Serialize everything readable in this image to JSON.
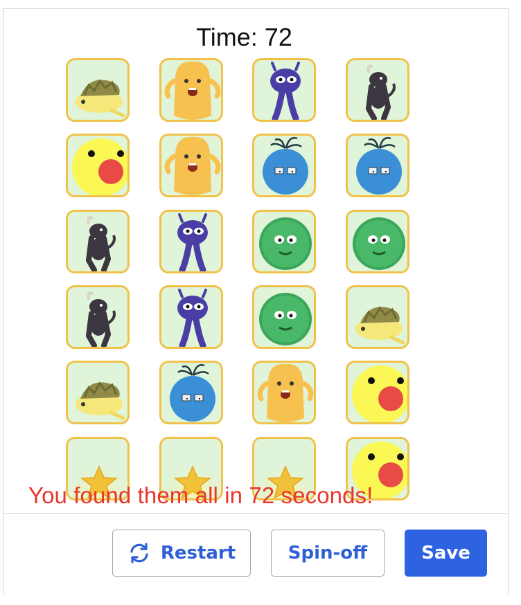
{
  "timer": {
    "text": "Time: 72"
  },
  "board": {
    "columns": 4,
    "rows": 6,
    "cards": [
      "yellow-turtle-icon",
      "orange-monster-icon",
      "purple-alien-icon",
      "dark-goat-icon",
      "yellow-chick-icon",
      "orange-monster-icon",
      "blue-ball-icon",
      "blue-ball-icon",
      "dark-goat-icon",
      "purple-alien-icon",
      "green-fuzzball-icon",
      "green-fuzzball-icon",
      "dark-goat-icon",
      "purple-alien-icon",
      "green-fuzzball-icon",
      "yellow-turtle-icon",
      "yellow-turtle-icon",
      "blue-ball-icon",
      "orange-monster-icon",
      "yellow-chick-icon",
      "gold-star-icon",
      "gold-star-icon",
      "gold-star-icon",
      "yellow-chick-icon"
    ]
  },
  "message": {
    "text": "You found them all in 72 seconds!",
    "color": "#e8362d"
  },
  "toolbar": {
    "restart_label": "Restart",
    "spinoff_label": "Spin-off",
    "save_label": "Save"
  },
  "colors": {
    "card_border": "#f1c24a",
    "card_background": "#dff4d8",
    "accent": "#2d63e1"
  }
}
